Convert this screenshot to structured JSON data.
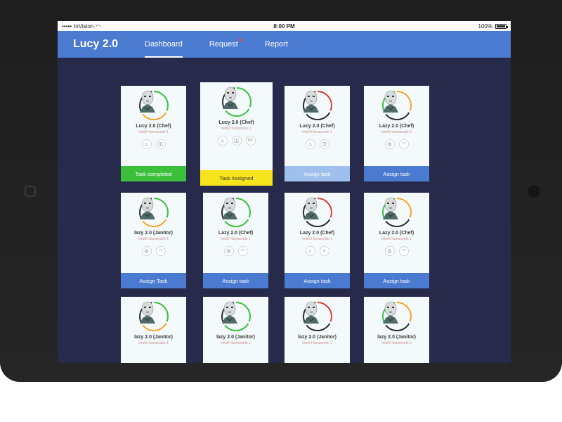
{
  "statusbar": {
    "carrier": "InVision",
    "time": "8:00 PM",
    "battery": "100%"
  },
  "nav": {
    "brand": "Lucy 2.0",
    "tabs": [
      {
        "label": "Dashboard",
        "active": true
      },
      {
        "label": "Request",
        "notification": true
      },
      {
        "label": "Report"
      }
    ]
  },
  "colors": {
    "accent": "#4a7bd1",
    "screen_bg": "#272a4a",
    "completed": "#3cc03c",
    "assigned": "#f6e51c"
  },
  "cards": [
    {
      "name": "Lucy 2.0 (Chef)",
      "subtitle": "Intelli Humanoide 1",
      "icons": [
        "flame-icon",
        "pot-icon"
      ],
      "action": "Task completed",
      "state": "completed"
    },
    {
      "name": "Lucy 2.0 (Chef)",
      "subtitle": "Intelli Humanoide 1",
      "icons": [
        "flame-icon",
        "pot-icon"
      ],
      "badge": "02",
      "action": "Task Assigned",
      "state": "assigned"
    },
    {
      "name": "Lucy 2.0 (Chef)",
      "subtitle": "Intelli Humanoide 1",
      "icons": [
        "flame-icon",
        "pot-icon"
      ],
      "action": "Assign task",
      "state": "pending"
    },
    {
      "name": "Lazy 2.0 (Chef)",
      "subtitle": "Intelli Humanoide 1",
      "icons": [
        "dishes-icon",
        "cloche-icon"
      ],
      "action": "Assign task",
      "state": "available"
    },
    {
      "name": "lazy 2.0 (Janitor)",
      "subtitle": "Intelli Humanoide 1",
      "icons": [
        "dishes-icon",
        "cloche-icon"
      ],
      "action": "Assign Task",
      "state": "available"
    },
    {
      "name": "Lazy 2.0 (Chef)",
      "subtitle": "Intelli Humanoide 1",
      "icons": [
        "dishes-icon",
        "cloche-icon"
      ],
      "action": "Assign task",
      "state": "available"
    },
    {
      "name": "Lazy 2.0 (Chef)",
      "subtitle": "Intelli Humanoide 1",
      "icons": [
        "broom-icon",
        "bucket-icon"
      ],
      "action": "Assign task",
      "state": "available"
    },
    {
      "name": "Lazy 2.0 (Chef)",
      "subtitle": "Intelli Humanoide 1",
      "icons": [
        "dishes-icon",
        "cloche-icon"
      ],
      "action": "Assign task",
      "state": "available"
    },
    {
      "name": "lazy 2.0 (Janitor)",
      "subtitle": "Intelli Humanoide 1"
    },
    {
      "name": "lazy 2.0 (Janitor)",
      "subtitle": "Intelli Humanoide 1"
    },
    {
      "name": "lazy 2.0 (Janitor)",
      "subtitle": "Intelli Humanoide 1"
    },
    {
      "name": "lazy 2.0 (Janitor)",
      "subtitle": "Intelli Humanoide 1"
    }
  ]
}
